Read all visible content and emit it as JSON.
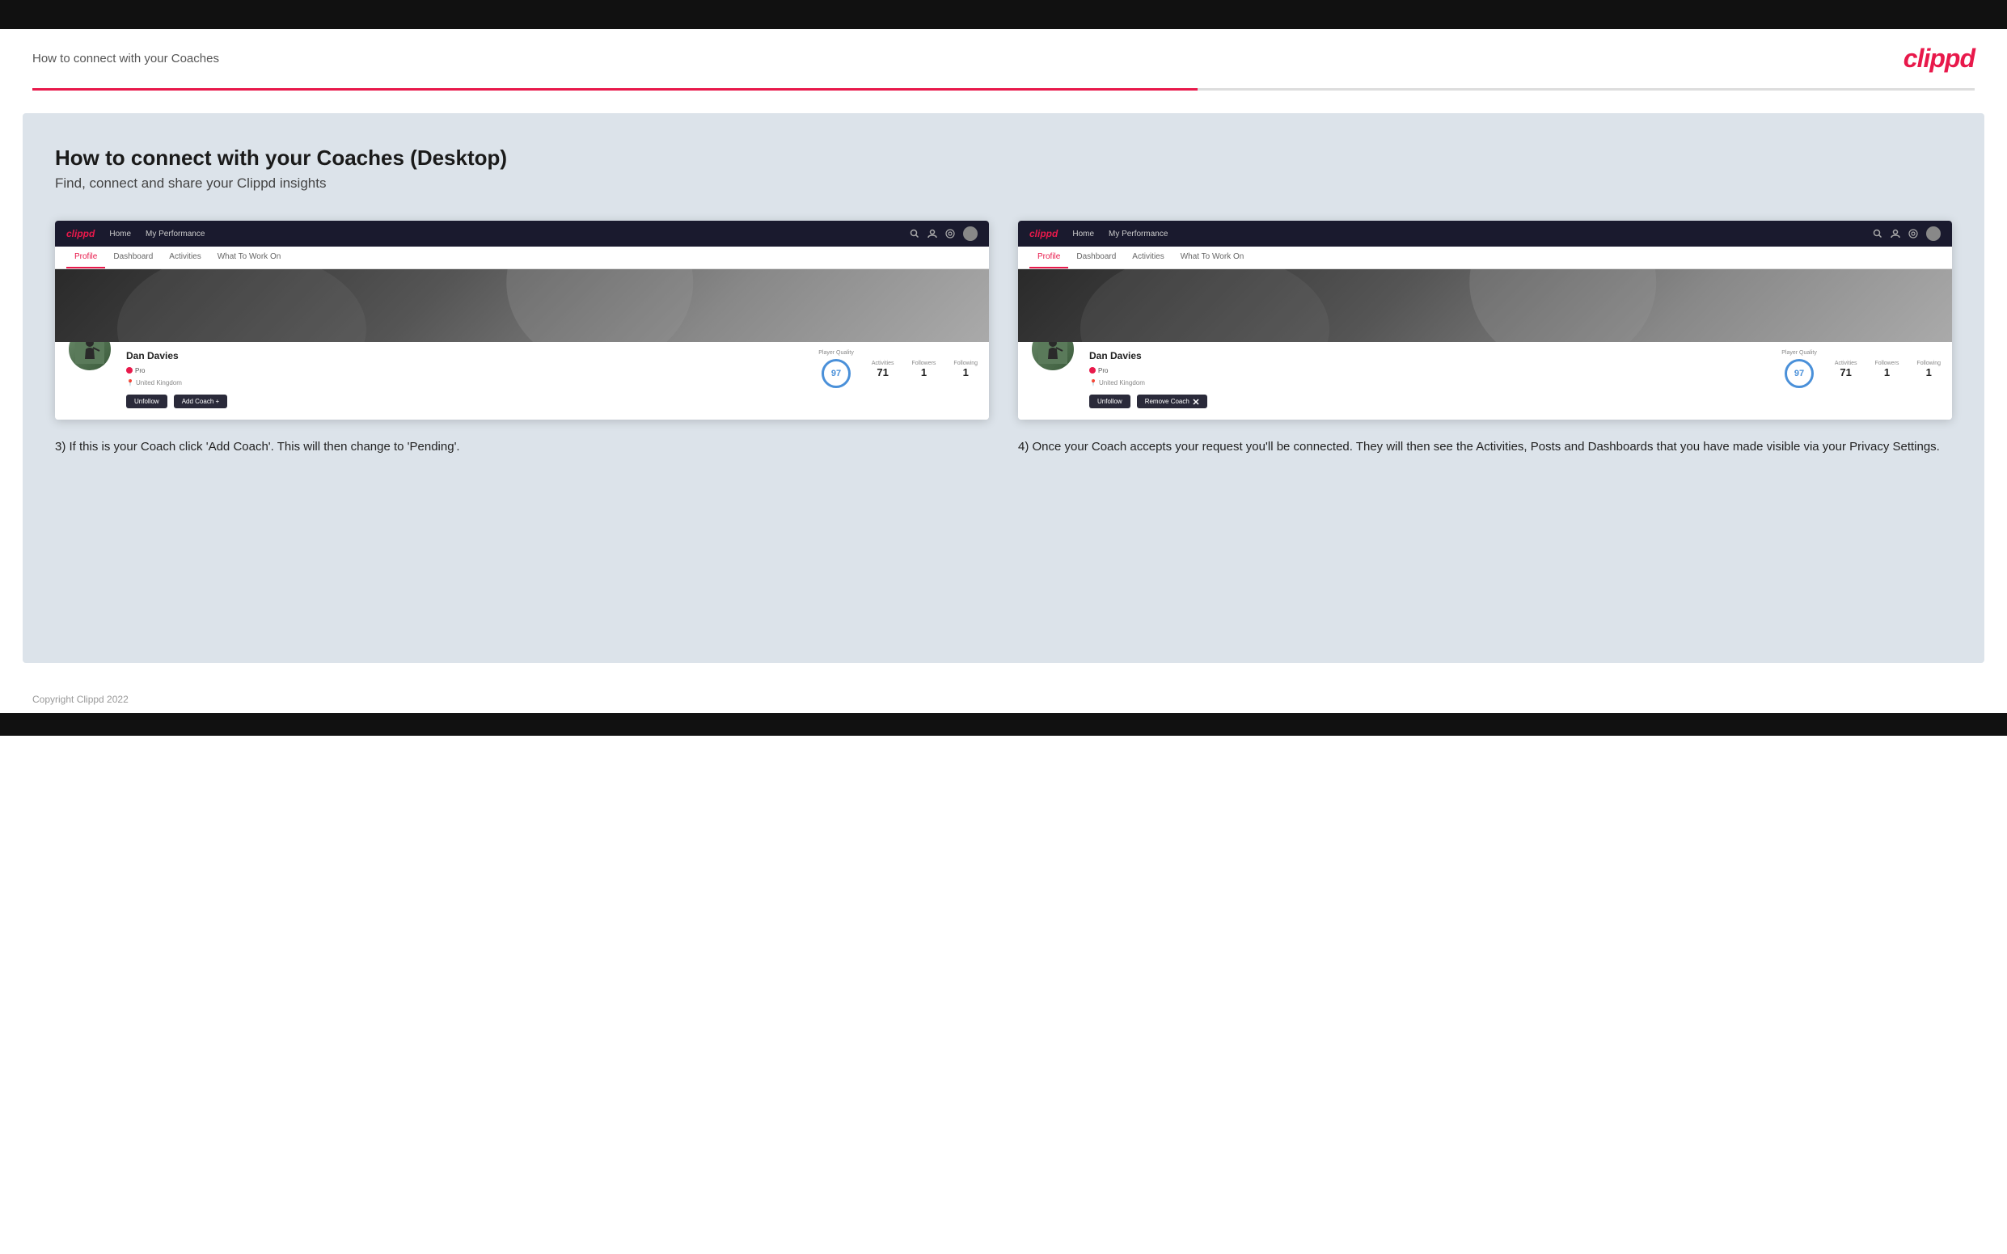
{
  "header": {
    "title": "How to connect with your Coaches",
    "logo": "clippd"
  },
  "main": {
    "title": "How to connect with your Coaches (Desktop)",
    "subtitle": "Find, connect and share your Clippd insights"
  },
  "screenshot_left": {
    "nav": {
      "logo": "clippd",
      "items": [
        "Home",
        "My Performance"
      ],
      "icons": [
        "search",
        "user",
        "settings",
        "avatar"
      ]
    },
    "tabs": [
      "Profile",
      "Dashboard",
      "Activities",
      "What To Work On"
    ],
    "active_tab": "Profile",
    "profile": {
      "name": "Dan Davies",
      "badge": "Pro",
      "location": "United Kingdom",
      "player_quality_label": "Player Quality",
      "player_quality_value": "97",
      "stats": [
        {
          "label": "Activities",
          "value": "71"
        },
        {
          "label": "Followers",
          "value": "1"
        },
        {
          "label": "Following",
          "value": "1"
        }
      ],
      "buttons": [
        "Unfollow",
        "Add Coach"
      ]
    }
  },
  "screenshot_right": {
    "nav": {
      "logo": "clippd",
      "items": [
        "Home",
        "My Performance"
      ],
      "icons": [
        "search",
        "user",
        "settings",
        "avatar"
      ]
    },
    "tabs": [
      "Profile",
      "Dashboard",
      "Activities",
      "What To Work On"
    ],
    "active_tab": "Profile",
    "profile": {
      "name": "Dan Davies",
      "badge": "Pro",
      "location": "United Kingdom",
      "player_quality_label": "Player Quality",
      "player_quality_value": "97",
      "stats": [
        {
          "label": "Activities",
          "value": "71"
        },
        {
          "label": "Followers",
          "value": "1"
        },
        {
          "label": "Following",
          "value": "1"
        }
      ],
      "buttons": [
        "Unfollow",
        "Remove Coach ×"
      ]
    }
  },
  "caption_left": "3) If this is your Coach click 'Add Coach'. This will then change to 'Pending'.",
  "caption_right": "4) Once your Coach accepts your request you'll be connected. They will then see the Activities, Posts and Dashboards that you have made visible via your Privacy Settings.",
  "footer": {
    "copyright": "Copyright Clippd 2022"
  }
}
